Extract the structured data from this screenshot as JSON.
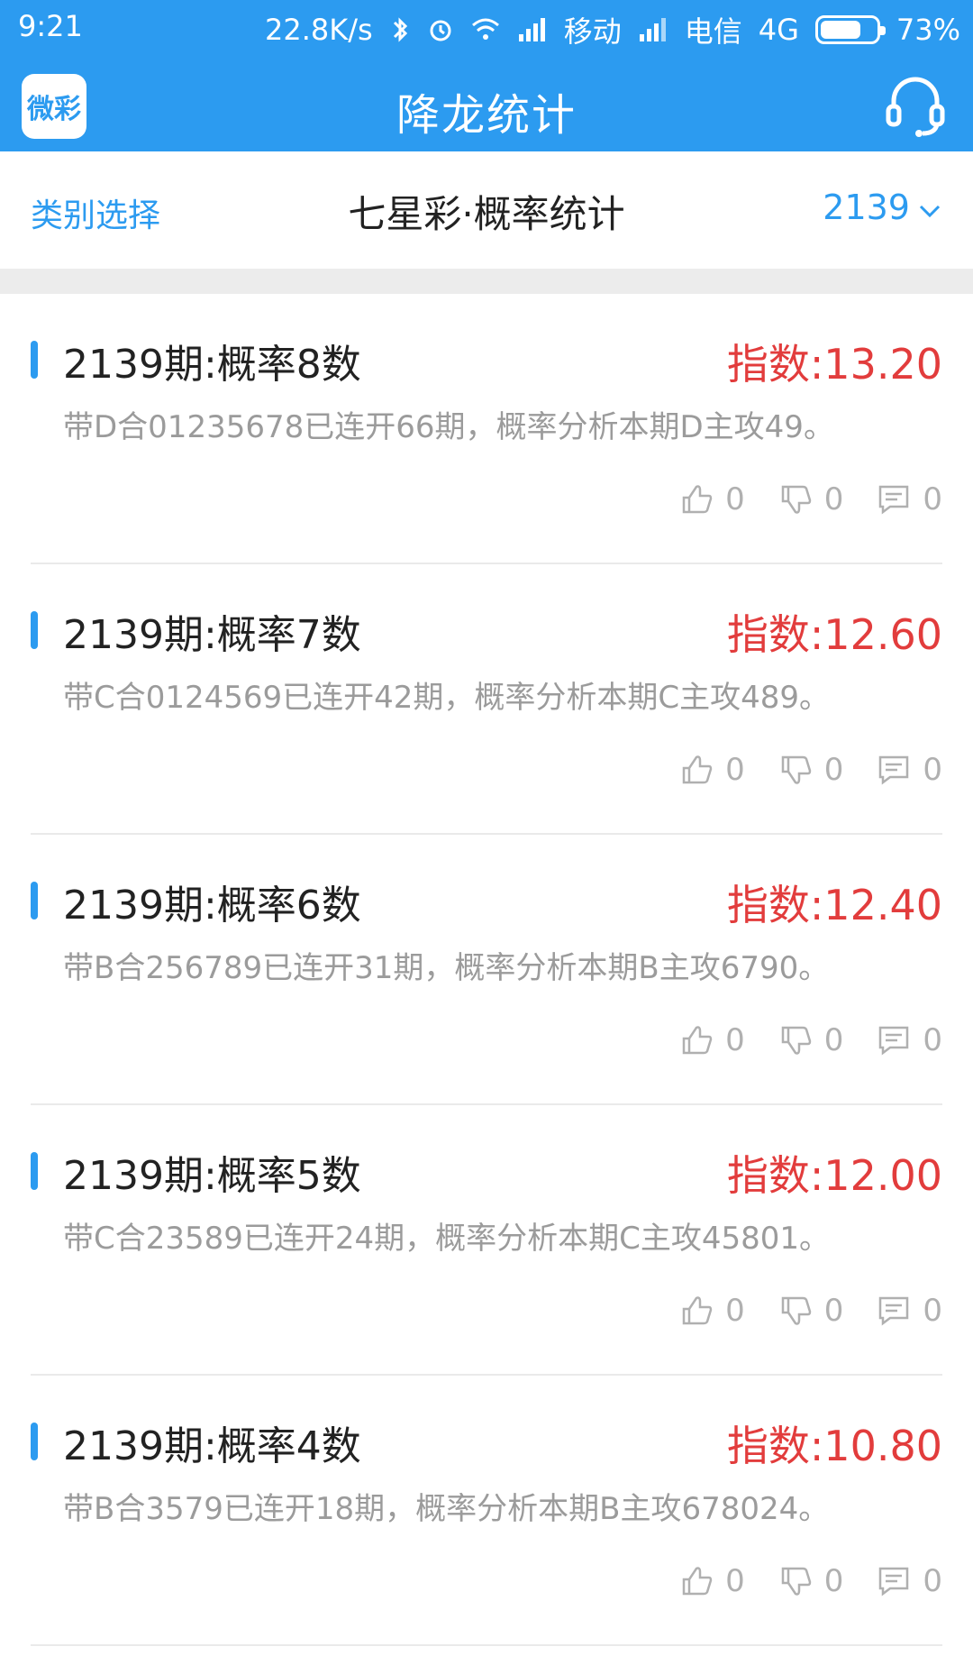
{
  "status": {
    "time": "9:21",
    "speed": "22.8K/s",
    "carrier1": "移动",
    "carrier2": "电信",
    "network": "4G",
    "battery_percent": "73%"
  },
  "app": {
    "logo_text": "微彩",
    "title": "降龙统计"
  },
  "subheader": {
    "category_label": "类别选择",
    "title": "七星彩·概率统计",
    "issue_number": "2139"
  },
  "items": [
    {
      "title": "2139期:概率8数",
      "index": "指数:13.20",
      "desc": "带D合01235678已连开66期，概率分析本期D主攻49。",
      "likes": "0",
      "dislikes": "0",
      "comments": "0"
    },
    {
      "title": "2139期:概率7数",
      "index": "指数:12.60",
      "desc": "带C合0124569已连开42期，概率分析本期C主攻489。",
      "likes": "0",
      "dislikes": "0",
      "comments": "0"
    },
    {
      "title": "2139期:概率6数",
      "index": "指数:12.40",
      "desc": "带B合256789已连开31期，概率分析本期B主攻6790。",
      "likes": "0",
      "dislikes": "0",
      "comments": "0"
    },
    {
      "title": "2139期:概率5数",
      "index": "指数:12.00",
      "desc": "带C合23589已连开24期，概率分析本期C主攻45801。",
      "likes": "0",
      "dislikes": "0",
      "comments": "0"
    },
    {
      "title": "2139期:概率4数",
      "index": "指数:10.80",
      "desc": "带B合3579已连开18期，概率分析本期B主攻678024。",
      "likes": "0",
      "dislikes": "0",
      "comments": "0"
    }
  ],
  "colors": {
    "accent": "#2c9bf0",
    "index_red": "#e23c3c",
    "desc_gray": "#9b9b9b"
  }
}
